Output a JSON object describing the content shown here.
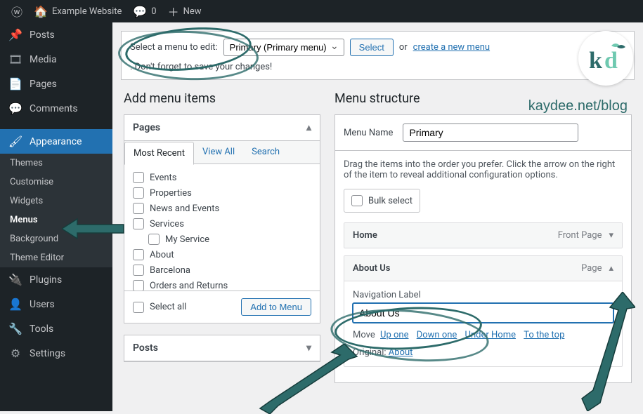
{
  "adminbar": {
    "site_name": "Example Website",
    "comments_count": "0",
    "new_label": "New"
  },
  "sidebar": {
    "items": [
      {
        "icon": "📌",
        "label": "Posts"
      },
      {
        "icon": "🎞",
        "label": "Media"
      },
      {
        "icon": "📄",
        "label": "Pages"
      },
      {
        "icon": "💬",
        "label": "Comments"
      }
    ],
    "appearance_label": "Appearance",
    "appearance_icon": "🖌",
    "sub": [
      "Themes",
      "Customise",
      "Widgets",
      "Menus",
      "Background",
      "Theme Editor"
    ],
    "items2": [
      {
        "icon": "🔌",
        "label": "Plugins"
      },
      {
        "icon": "👤",
        "label": "Users"
      },
      {
        "icon": "🔧",
        "label": "Tools"
      },
      {
        "icon": "⚙",
        "label": "Settings"
      }
    ]
  },
  "tablenav": {
    "select_label": "Select a menu to edit:",
    "select_value": "Primary (Primary menu)",
    "select_btn": "Select",
    "or": "or",
    "create_link": "create a new menu",
    "remind": ". Don't forget to save your changes!"
  },
  "left": {
    "heading": "Add menu items",
    "pages_header": "Pages",
    "tabs": [
      "Most Recent",
      "View All",
      "Search"
    ],
    "pages": [
      "Events",
      "Properties",
      "News and Events",
      "Services",
      "My Service",
      "About",
      "Barcelona",
      "Orders and Returns"
    ],
    "select_all": "Select all",
    "add_btn": "Add to Menu",
    "posts_header": "Posts"
  },
  "right": {
    "heading": "Menu structure",
    "menu_name_label": "Menu Name",
    "menu_name_value": "Primary",
    "instructions": "Drag the items into the order you prefer. Click the arrow on the right of the item to reveal additional configuration options.",
    "bulk_label": "Bulk select",
    "items": [
      {
        "title": "Home",
        "type": "Front Page"
      },
      {
        "title": "About Us",
        "type": "Page"
      }
    ],
    "nav_label": "Navigation Label",
    "nav_value": "About Us",
    "move_label": "Move",
    "move_links": [
      "Up one",
      "Down one",
      "Under Home",
      "To the top"
    ],
    "original_label": "Original:",
    "original_link": "About"
  },
  "credit": "kaydee.net/blog"
}
